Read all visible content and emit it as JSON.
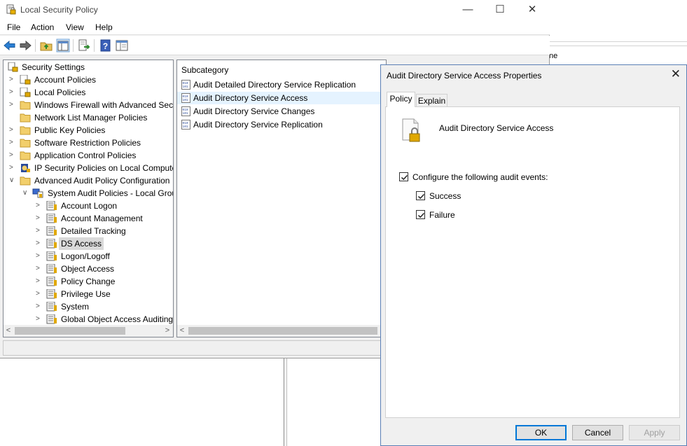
{
  "background": {
    "partial_text": "ne"
  },
  "window": {
    "title": "Local Security Policy",
    "minimize_glyph": "—",
    "maximize_glyph": "☐",
    "close_glyph": "✕"
  },
  "menu": [
    {
      "label": "File"
    },
    {
      "label": "Action"
    },
    {
      "label": "View"
    },
    {
      "label": "Help"
    }
  ],
  "toolbar": {
    "buttons": [
      "back-icon",
      "forward-icon",
      "up-folder-icon",
      "show-hide-tree-icon",
      "export-list-icon",
      "help-icon",
      "properties-view-icon"
    ]
  },
  "tree": {
    "root": "Security Settings",
    "items": [
      {
        "label": "Account Policies"
      },
      {
        "label": "Local Policies"
      },
      {
        "label": "Windows Firewall with Advanced Secu"
      },
      {
        "label": "Network List Manager Policies"
      },
      {
        "label": "Public Key Policies"
      },
      {
        "label": "Software Restriction Policies"
      },
      {
        "label": "Application Control Policies"
      },
      {
        "label": "IP Security Policies on Local Compute"
      },
      {
        "label": "Advanced Audit Policy Configuration"
      }
    ],
    "system_audit": "System Audit Policies - Local Grou",
    "sub_items": [
      {
        "label": "Account Logon"
      },
      {
        "label": "Account Management"
      },
      {
        "label": "Detailed Tracking"
      },
      {
        "label": "DS Access"
      },
      {
        "label": "Logon/Logoff"
      },
      {
        "label": "Object Access"
      },
      {
        "label": "Policy Change"
      },
      {
        "label": "Privilege Use"
      },
      {
        "label": "System"
      },
      {
        "label": "Global Object Access Auditing"
      }
    ],
    "selected": "DS Access"
  },
  "list": {
    "header": "Subcategory",
    "rows": [
      {
        "label": "Audit Detailed Directory Service Replication"
      },
      {
        "label": "Audit Directory Service Access"
      },
      {
        "label": "Audit Directory Service Changes"
      },
      {
        "label": "Audit Directory Service Replication"
      }
    ],
    "selected": "Audit Directory Service Access"
  },
  "dialog": {
    "title": "Audit Directory Service Access Properties",
    "close_glyph": "✕",
    "tabs": [
      {
        "label": "Policy",
        "active": true
      },
      {
        "label": "Explain",
        "active": false
      }
    ],
    "policy_name": "Audit Directory Service Access",
    "configure_label": "Configure the following audit events:",
    "configure_checked": true,
    "success_label": "Success",
    "success_checked": true,
    "failure_label": "Failure",
    "failure_checked": true,
    "buttons": {
      "ok": "OK",
      "cancel": "Cancel",
      "apply": "Apply"
    }
  },
  "colors": {
    "selection_tree": "#d9d9d9",
    "selection_list": "#e5f3ff",
    "dialog_border": "#5a7fb5",
    "default_button_border": "#0078d7"
  }
}
